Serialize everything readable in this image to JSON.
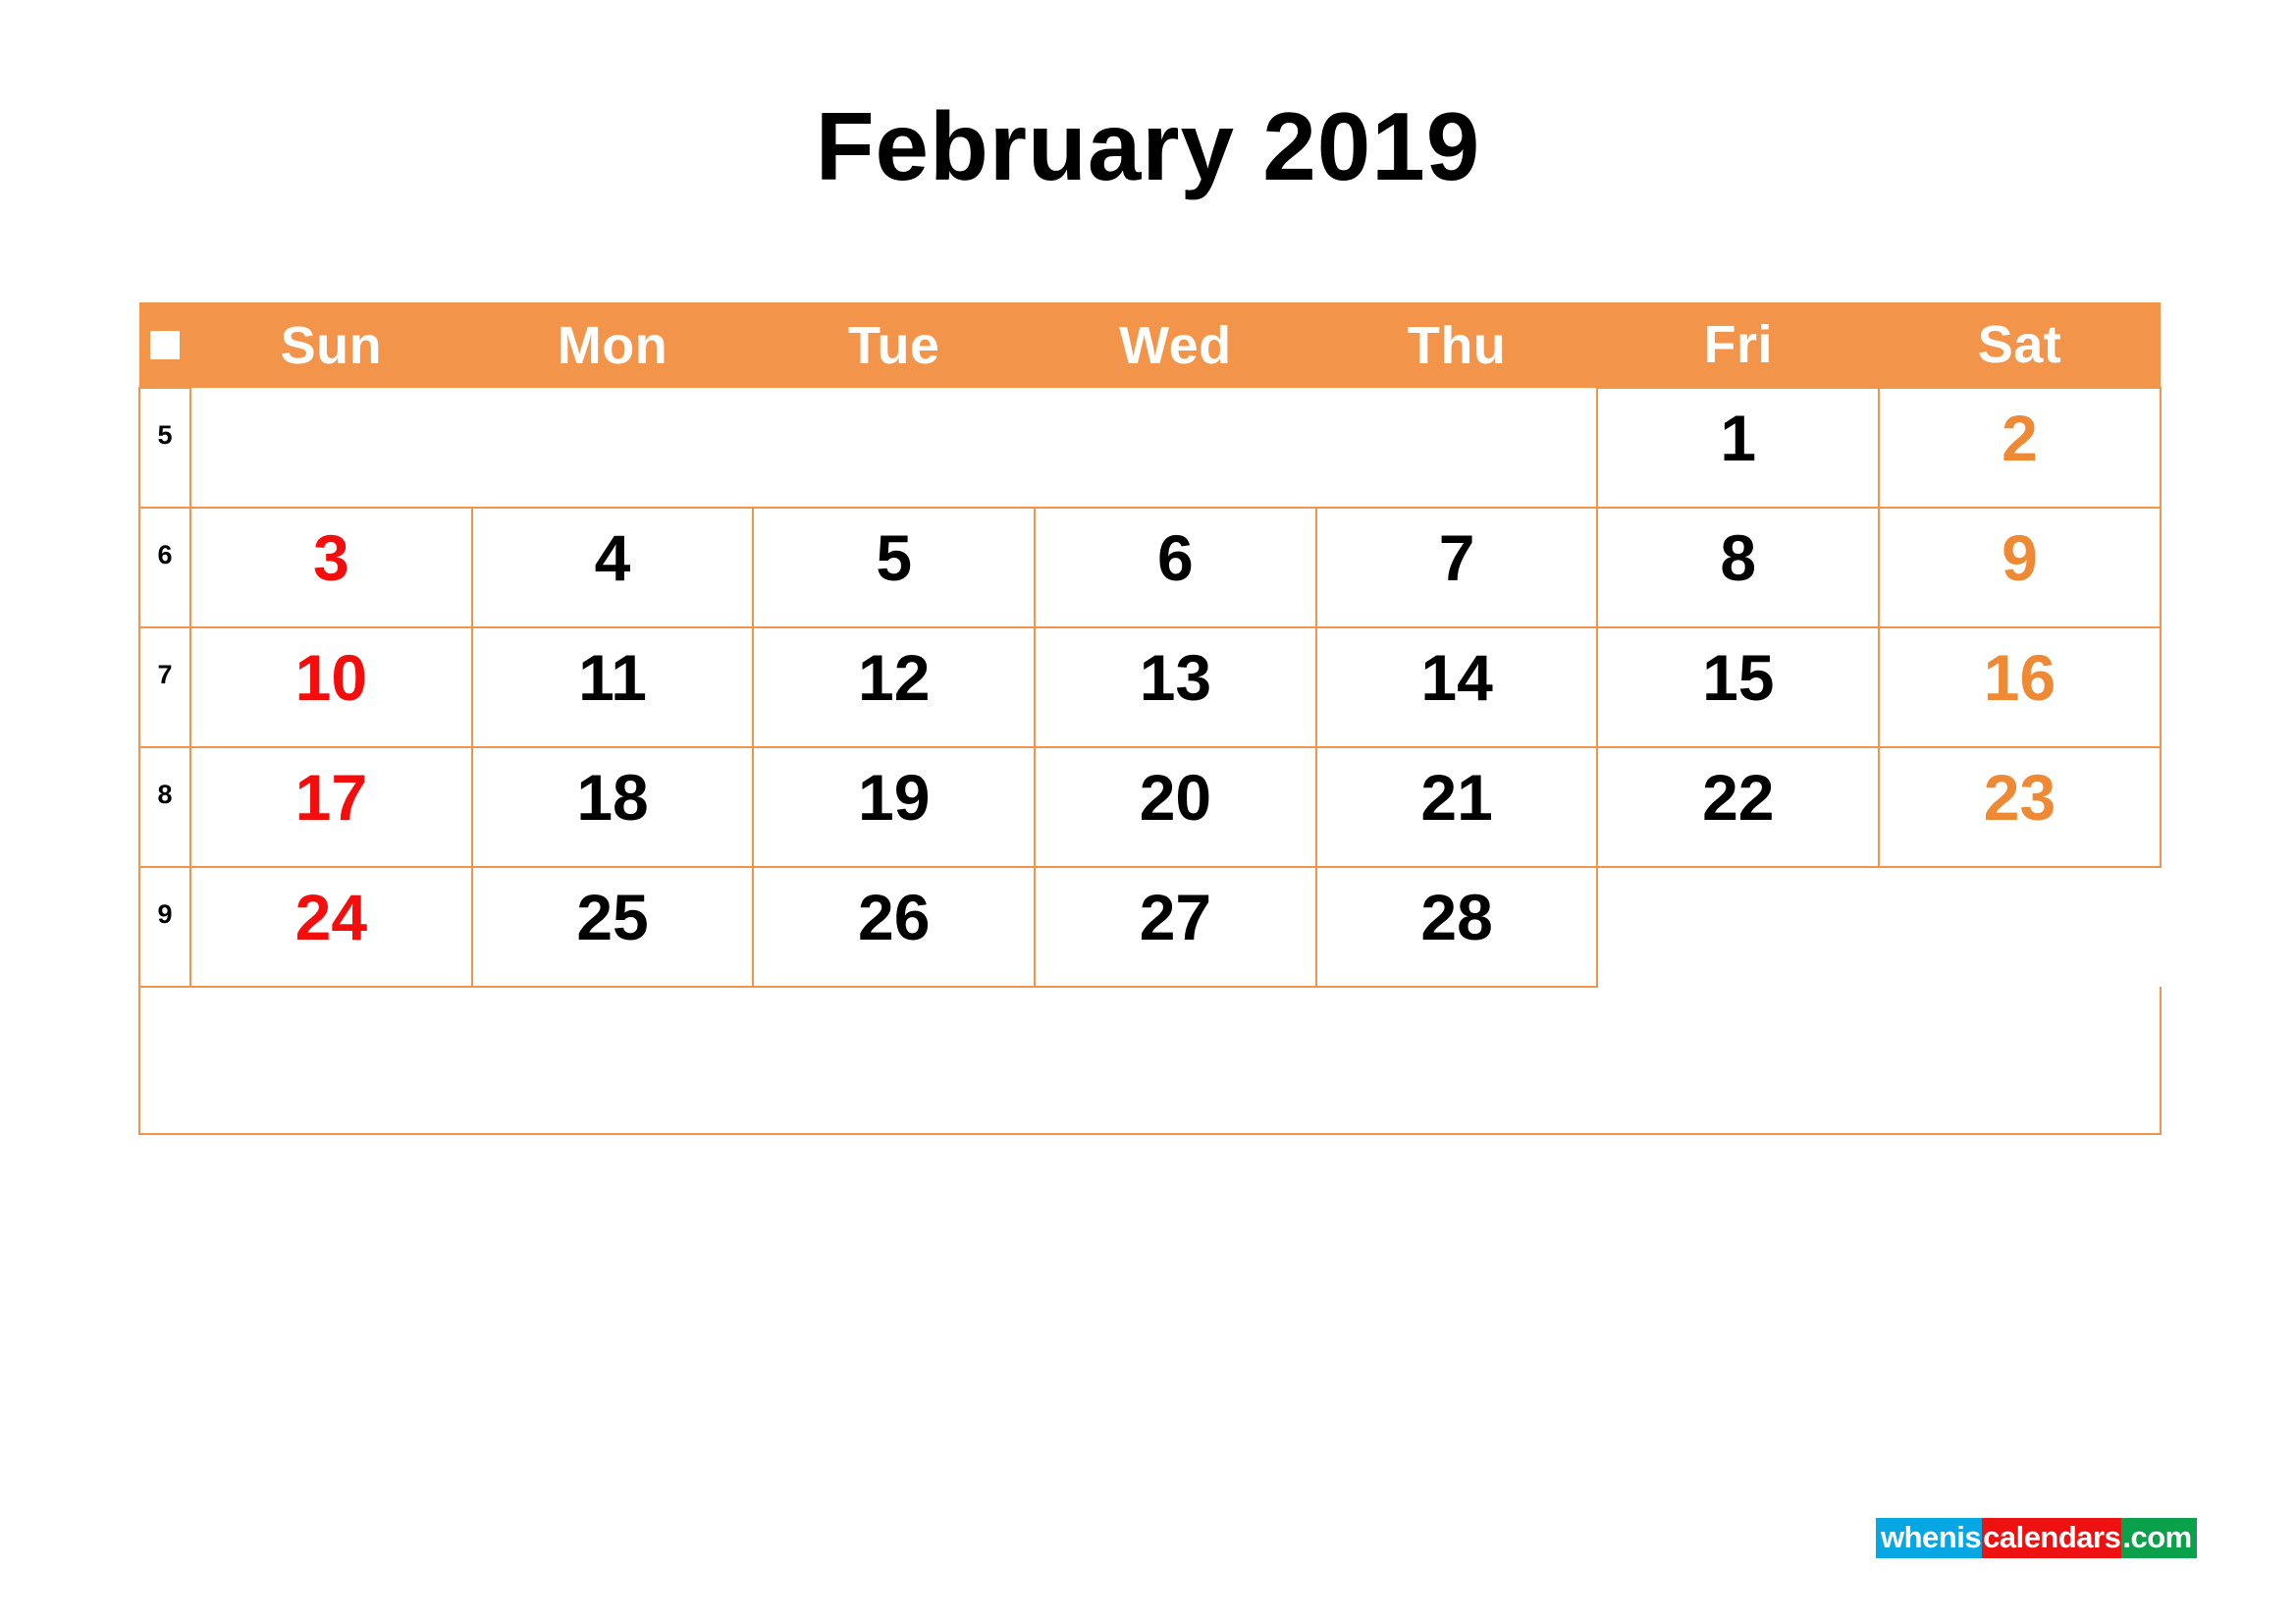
{
  "title": "February 2019",
  "colors": {
    "accent_orange": "#F2954A",
    "border_orange": "#F2954A",
    "sunday_red": "#F40D0D",
    "saturday_orange": "#EE8936",
    "weekday_black": "#000000",
    "header_text": "#FFFFFF",
    "logo_blue": "#06A7E2",
    "logo_red": "#EE1111",
    "logo_green": "#0BA14B"
  },
  "header": {
    "week_icon": "white-square-icon",
    "days": [
      "Sun",
      "Mon",
      "Tue",
      "Wed",
      "Thu",
      "Fri",
      "Sat"
    ]
  },
  "weeks": [
    {
      "week_number": "5",
      "days": [
        {
          "label": "",
          "color": "none",
          "empty": true
        },
        {
          "label": "",
          "color": "none",
          "empty": true
        },
        {
          "label": "",
          "color": "none",
          "empty": true
        },
        {
          "label": "",
          "color": "none",
          "empty": true
        },
        {
          "label": "",
          "color": "none",
          "empty": true
        },
        {
          "label": "1",
          "color": "black",
          "empty": false
        },
        {
          "label": "2",
          "color": "orange",
          "empty": false
        }
      ]
    },
    {
      "week_number": "6",
      "days": [
        {
          "label": "3",
          "color": "red",
          "empty": false
        },
        {
          "label": "4",
          "color": "black",
          "empty": false
        },
        {
          "label": "5",
          "color": "black",
          "empty": false
        },
        {
          "label": "6",
          "color": "black",
          "empty": false
        },
        {
          "label": "7",
          "color": "black",
          "empty": false
        },
        {
          "label": "8",
          "color": "black",
          "empty": false
        },
        {
          "label": "9",
          "color": "orange",
          "empty": false
        }
      ]
    },
    {
      "week_number": "7",
      "days": [
        {
          "label": "10",
          "color": "red",
          "empty": false
        },
        {
          "label": "11",
          "color": "black",
          "empty": false
        },
        {
          "label": "12",
          "color": "black",
          "empty": false
        },
        {
          "label": "13",
          "color": "black",
          "empty": false
        },
        {
          "label": "14",
          "color": "black",
          "empty": false
        },
        {
          "label": "15",
          "color": "black",
          "empty": false
        },
        {
          "label": "16",
          "color": "orange",
          "empty": false
        }
      ]
    },
    {
      "week_number": "8",
      "days": [
        {
          "label": "17",
          "color": "red",
          "empty": false
        },
        {
          "label": "18",
          "color": "black",
          "empty": false
        },
        {
          "label": "19",
          "color": "black",
          "empty": false
        },
        {
          "label": "20",
          "color": "black",
          "empty": false
        },
        {
          "label": "21",
          "color": "black",
          "empty": false
        },
        {
          "label": "22",
          "color": "black",
          "empty": false
        },
        {
          "label": "23",
          "color": "orange",
          "empty": false
        }
      ]
    },
    {
      "week_number": "9",
      "days": [
        {
          "label": "24",
          "color": "red",
          "empty": false
        },
        {
          "label": "25",
          "color": "black",
          "empty": false
        },
        {
          "label": "26",
          "color": "black",
          "empty": false
        },
        {
          "label": "27",
          "color": "black",
          "empty": false
        },
        {
          "label": "28",
          "color": "black",
          "empty": false
        },
        {
          "label": "",
          "color": "none",
          "empty": true
        },
        {
          "label": "",
          "color": "none",
          "empty": true
        }
      ]
    }
  ],
  "logo": {
    "part1": "whenis",
    "part2": "calendars",
    "part3": ".com"
  }
}
